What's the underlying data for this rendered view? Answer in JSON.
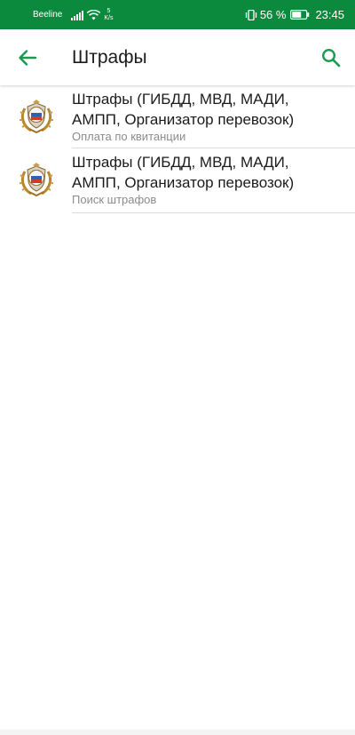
{
  "status_bar": {
    "carrier": "Beeline",
    "net_speed_value": "5",
    "net_speed_unit": "K/s",
    "battery_percent": "56 %",
    "time": "23:45"
  },
  "header": {
    "title": "Штрафы",
    "back_icon": "arrow-left-icon",
    "search_icon": "search-icon"
  },
  "list": {
    "items": [
      {
        "title": "Штрафы (ГИБДД, МВД, МАДИ, АМПП, Организатор перевозок)",
        "subtitle": "Оплата по квитанции",
        "icon": "traffic-police-emblem-icon"
      },
      {
        "title": "Штрафы (ГИБДД, МВД, МАДИ, АМПП, Организатор перевозок)",
        "subtitle": "Поиск штрафов",
        "icon": "traffic-police-emblem-icon"
      }
    ]
  },
  "colors": {
    "status_bar": "#0b8a3e",
    "accent": "#1a9a50"
  }
}
